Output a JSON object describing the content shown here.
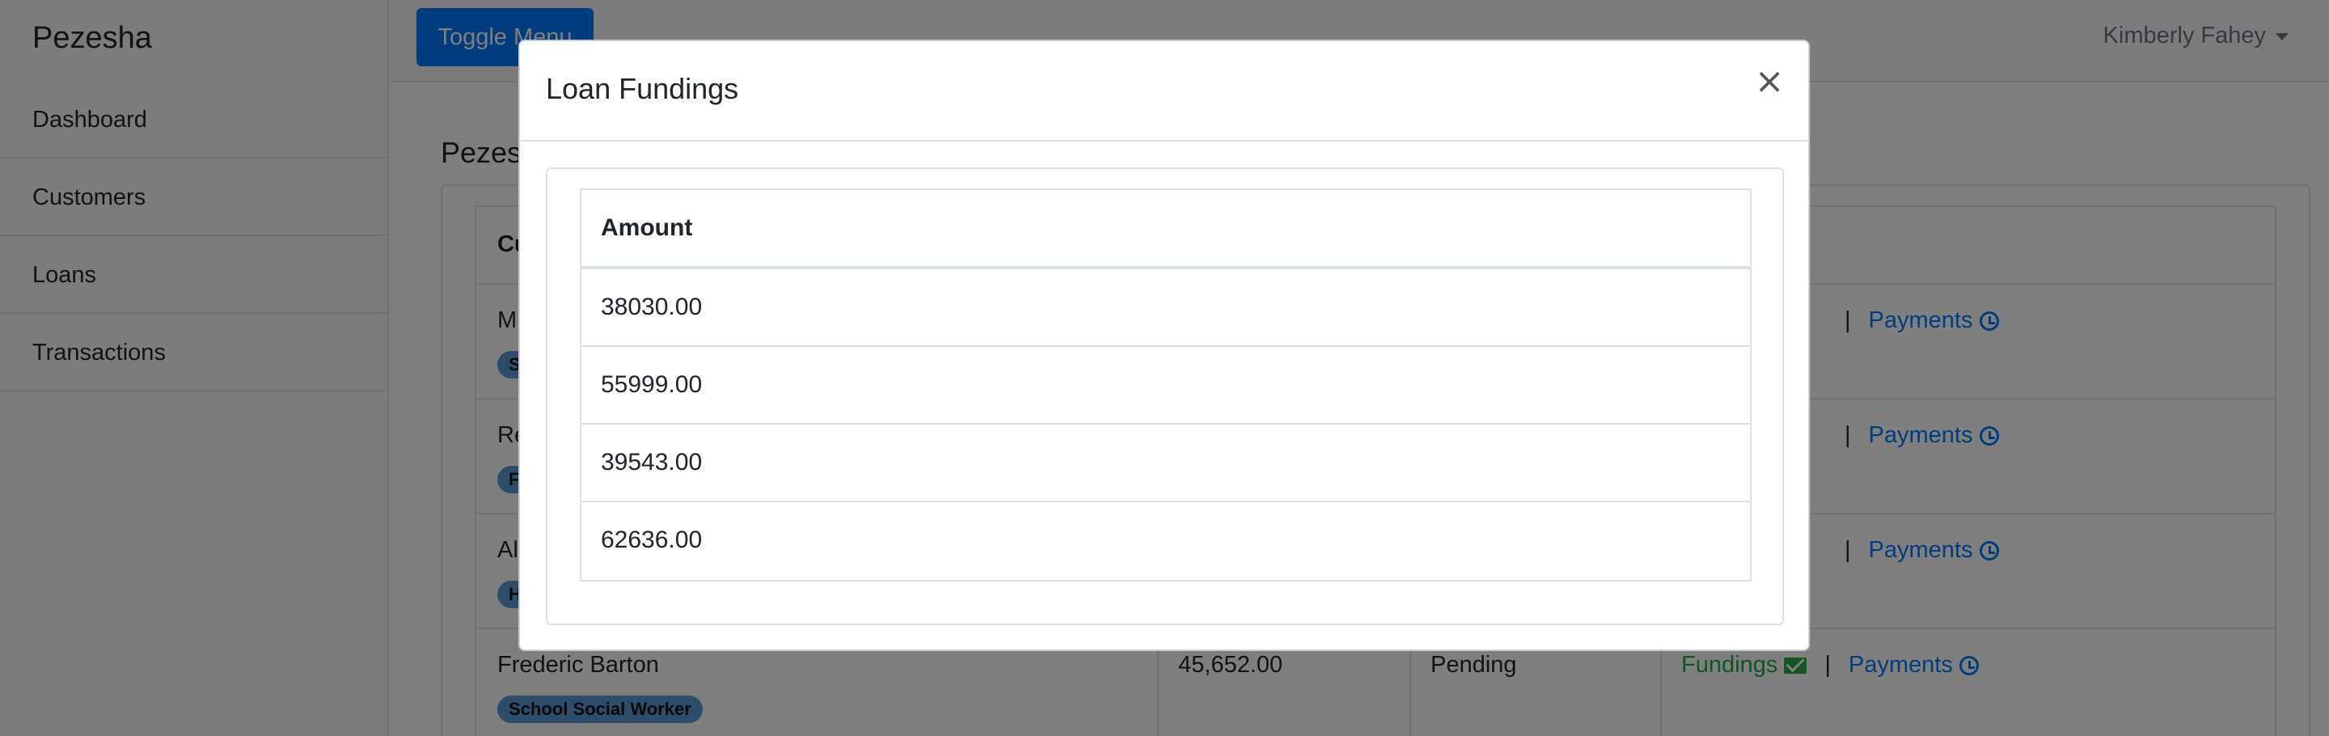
{
  "app": {
    "brand": "Pezesha"
  },
  "sidebar": {
    "items": [
      {
        "label": "Dashboard"
      },
      {
        "label": "Customers"
      },
      {
        "label": "Loans"
      },
      {
        "label": "Transactions"
      }
    ]
  },
  "topbar": {
    "toggle_label": "Toggle Menu",
    "user_name": "Kimberly Fahey"
  },
  "main": {
    "title_partial": "Pezes",
    "table": {
      "header_partial": "Cu",
      "rows": [
        {
          "name_partial": "Mi",
          "badge_partial": "S",
          "fundings": "",
          "payments": "Payments"
        },
        {
          "name_partial": "Re",
          "badge_partial": "F",
          "fundings": "",
          "payments": "Payments"
        },
        {
          "name_partial": "Al",
          "badge_partial": "H",
          "fundings": "",
          "payments": "Payments"
        },
        {
          "name": "Frederic Barton",
          "badge": "School Social Worker",
          "amount": "45,652.00",
          "status": "Pending",
          "fundings": "Fundings",
          "payments": "Payments"
        }
      ]
    }
  },
  "modal": {
    "title": "Loan Fundings",
    "close_glyph": "×",
    "table_header": "Amount",
    "amounts": [
      "38030.00",
      "55999.00",
      "39543.00",
      "62636.00"
    ]
  },
  "colors": {
    "primary": "#007bff",
    "success": "#28a745",
    "badge": "#5b9bd5",
    "overlay": "rgba(0,0,0,0.5)"
  }
}
